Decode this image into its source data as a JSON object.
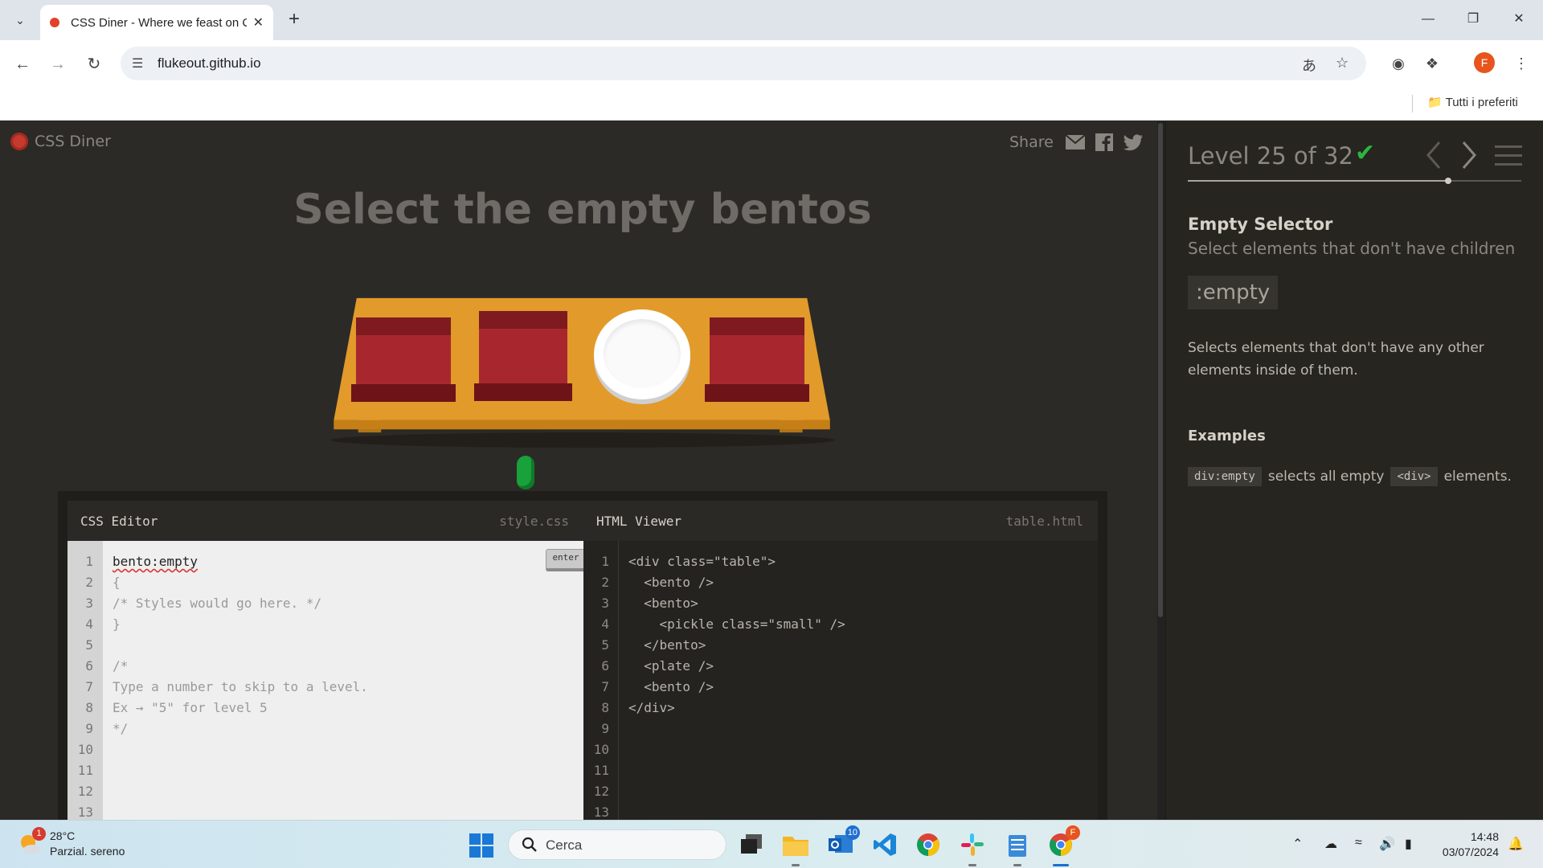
{
  "browser": {
    "tab_title": "CSS Diner - Where we feast on CSS Selectors!",
    "url": "flukeout.github.io",
    "bookmark_folder": "Tutti i preferiti",
    "profile_initial": "F"
  },
  "page": {
    "logo": "CSS Diner",
    "share_label": "Share",
    "instruction": "Select the empty bentos",
    "editor": {
      "css_title": "CSS Editor",
      "css_file": "style.css",
      "html_title": "HTML Viewer",
      "html_file": "table.html",
      "enter_label": "enter",
      "line_numbers": [
        "1",
        "2",
        "3",
        "4",
        "5",
        "6",
        "7",
        "8",
        "9",
        "10",
        "11",
        "12",
        "13"
      ],
      "css_input": "bento:empty",
      "css_lines": [
        "{",
        "/* Styles would go here. */",
        "}",
        "",
        "/*",
        "Type a number to skip to a level.",
        "Ex → \"5\" for level 5",
        "*/"
      ],
      "html_lines": [
        "<div class=\"table\">",
        "  <bento />",
        "  <bento>",
        "    <pickle class=\"small\" />",
        "  </bento>",
        "  <plate />",
        "  <bento />",
        "</div>"
      ]
    },
    "sidebar": {
      "level_text": "Level 25 of 32",
      "level_current": 25,
      "level_total": 32,
      "completed": true,
      "selector_name": "Empty Selector",
      "selector_title": "Select elements that don't have children",
      "syntax": ":empty",
      "hint": "Selects elements that don't have any other elements inside of them.",
      "examples_heading": "Examples",
      "example": {
        "code": "div:empty",
        "text_before": "selects all empty",
        "tag": "<div>",
        "text_after": "elements."
      }
    }
  },
  "taskbar": {
    "weather_temp": "28°C",
    "weather_desc": "Parzial. sereno",
    "weather_badge": "1",
    "search_placeholder": "Cerca",
    "mail_badge": "10",
    "time": "14:48",
    "date": "03/07/2024"
  },
  "colors": {
    "bento_red": "#a8272f",
    "table_orange": "#e29a2a",
    "check_green": "#2db43f",
    "pickle_green": "#19a13b"
  }
}
